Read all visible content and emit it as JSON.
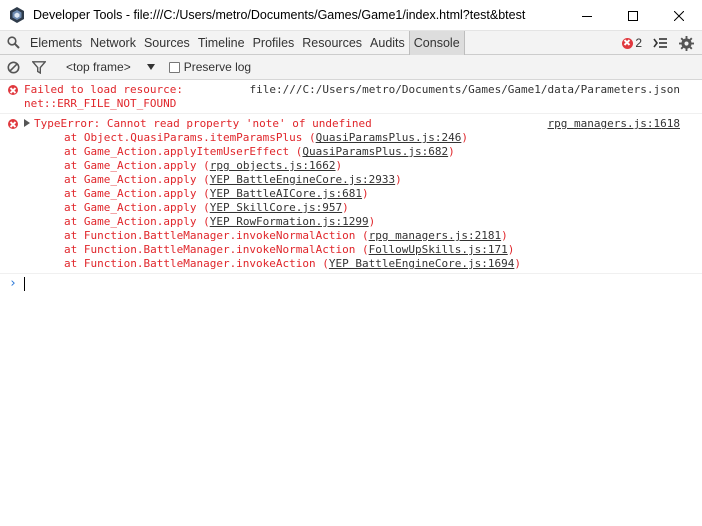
{
  "window": {
    "title": "Developer Tools - file:///C:/Users/metro/Documents/Games/Game1/index.html?test&btest"
  },
  "tabs": [
    {
      "label": "Elements"
    },
    {
      "label": "Network"
    },
    {
      "label": "Sources"
    },
    {
      "label": "Timeline"
    },
    {
      "label": "Profiles"
    },
    {
      "label": "Resources"
    },
    {
      "label": "Audits"
    },
    {
      "label": "Console",
      "active": true
    }
  ],
  "error_count": "2",
  "console_toolbar": {
    "frame": "<top frame>",
    "preserve_log": "Preserve log"
  },
  "messages": {
    "failed": {
      "text1": "Failed to load resource:",
      "url": "file:///C:/Users/metro/Documents/Games/Game1/data/Parameters.json",
      "text2": "net::ERR_FILE_NOT_FOUND"
    },
    "typeerror": {
      "text": "TypeError: Cannot read property 'note' of undefined",
      "source": "rpg managers.js:1618",
      "frames": [
        {
          "fn": "at Object.QuasiParams.itemParamsPlus (",
          "link": "QuasiParamsPlus.js:246",
          "close": ")"
        },
        {
          "fn": "at Game_Action.applyItemUserEffect (",
          "link": "QuasiParamsPlus.js:682",
          "close": ")"
        },
        {
          "fn": "at Game_Action.apply (",
          "link": "rpg objects.js:1662",
          "close": ")"
        },
        {
          "fn": "at Game_Action.apply (",
          "link": "YEP BattleEngineCore.js:2933",
          "close": ")"
        },
        {
          "fn": "at Game_Action.apply (",
          "link": "YEP BattleAICore.js:681",
          "close": ")"
        },
        {
          "fn": "at Game_Action.apply (",
          "link": "YEP SkillCore.js:957",
          "close": ")"
        },
        {
          "fn": "at Game_Action.apply (",
          "link": "YEP RowFormation.js:1299",
          "close": ")"
        },
        {
          "fn": "at Function.BattleManager.invokeNormalAction (",
          "link": "rpg managers.js:2181",
          "close": ")"
        },
        {
          "fn": "at Function.BattleManager.invokeNormalAction (",
          "link": "FollowUpSkills.js:171",
          "close": ")"
        },
        {
          "fn": "at Function.BattleManager.invokeAction (",
          "link": "YEP BattleEngineCore.js:1694",
          "close": ")"
        }
      ]
    }
  },
  "prompt": {
    "caret": "›"
  }
}
